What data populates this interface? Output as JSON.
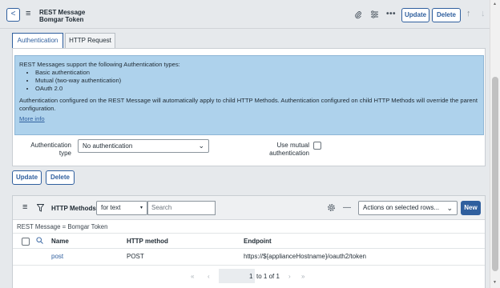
{
  "header": {
    "back_glyph": "<",
    "record_type": "REST Message",
    "record_name": "Bomgar Token",
    "update_label": "Update",
    "delete_label": "Delete",
    "icons": [
      "paperclip-icon",
      "settings-sliders-icon",
      "more-icon",
      "arrow-up-icon",
      "arrow-down-icon"
    ]
  },
  "tabs": [
    {
      "label": "Authentication",
      "active": true
    },
    {
      "label": "HTTP Request",
      "active": false
    }
  ],
  "info": {
    "intro": "REST Messages support the following Authentication types:",
    "types": [
      "Basic authentication",
      "Mutual (two-way authentication)",
      "OAuth 2.0"
    ],
    "note": "Authentication configured on the REST Message will automatically apply to child HTTP Methods. Authentication configured on child HTTP Methods will override the parent configuration.",
    "more_info": "More info"
  },
  "form": {
    "auth_type_label_1": "Authentication",
    "auth_type_label_2": "type",
    "auth_type_value": "No authentication",
    "mutual_label_1": "Use mutual",
    "mutual_label_2": "authentication",
    "mutual_checked": false,
    "update_label": "Update",
    "delete_label": "Delete"
  },
  "related_list": {
    "title": "HTTP Methods",
    "filter_field": "for text",
    "search_placeholder": "Search",
    "actions_placeholder": "Actions on selected rows...",
    "new_label": "New",
    "breadcrumb": "REST Message = Bomgar Token",
    "columns": [
      "Name",
      "HTTP method",
      "Endpoint"
    ],
    "rows": [
      {
        "name": "post",
        "method": "POST",
        "endpoint": "https://${applianceHostname}/oauth2/token"
      }
    ],
    "pager_text": "1",
    "pager_range": "to 1 of 1"
  },
  "colors": {
    "accent": "#2f5f9e",
    "info_bg": "#aed2ec"
  }
}
